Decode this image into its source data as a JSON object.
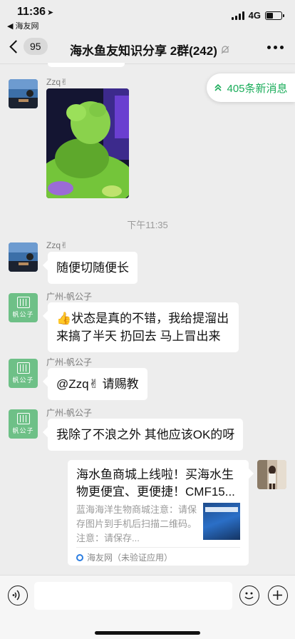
{
  "status_bar": {
    "time": "11:36",
    "back_app": "◀ 海友网",
    "network": "4G"
  },
  "nav": {
    "unread_count": "95",
    "title": "海水鱼友知识分享 2群(242)"
  },
  "new_messages": {
    "label": "405条新消息"
  },
  "messages": [
    {
      "sender": "Zzq✌",
      "type": "image"
    },
    {
      "time_divider": "下午11:35"
    },
    {
      "sender": "Zzq✌",
      "text": "随便切随便长"
    },
    {
      "sender": "广州-帆公子",
      "text_line1": "👍状态是真的不错，我给提溜出",
      "text_line2": "来搞了半天 扔回去 马上冒出来"
    },
    {
      "sender": "广州-帆公子",
      "text": "@Zzq✌ 请赐教"
    },
    {
      "sender": "广州-帆公子",
      "text": "我除了不浪之外 其他应该OK的呀"
    }
  ],
  "avatar_fan": {
    "label": "帆公子"
  },
  "link_card": {
    "title": "海水鱼商城上线啦！买海水生物更便宜、更便捷！CMF15...",
    "description": "蓝海海洋生物商城注意：请保存图片到手机后扫描二维码。注意：请保存...",
    "source": "海友网（未验证应用）"
  },
  "colors": {
    "accent_green": "#1aad5a",
    "background": "#ededed",
    "bubble": "#ffffff"
  }
}
